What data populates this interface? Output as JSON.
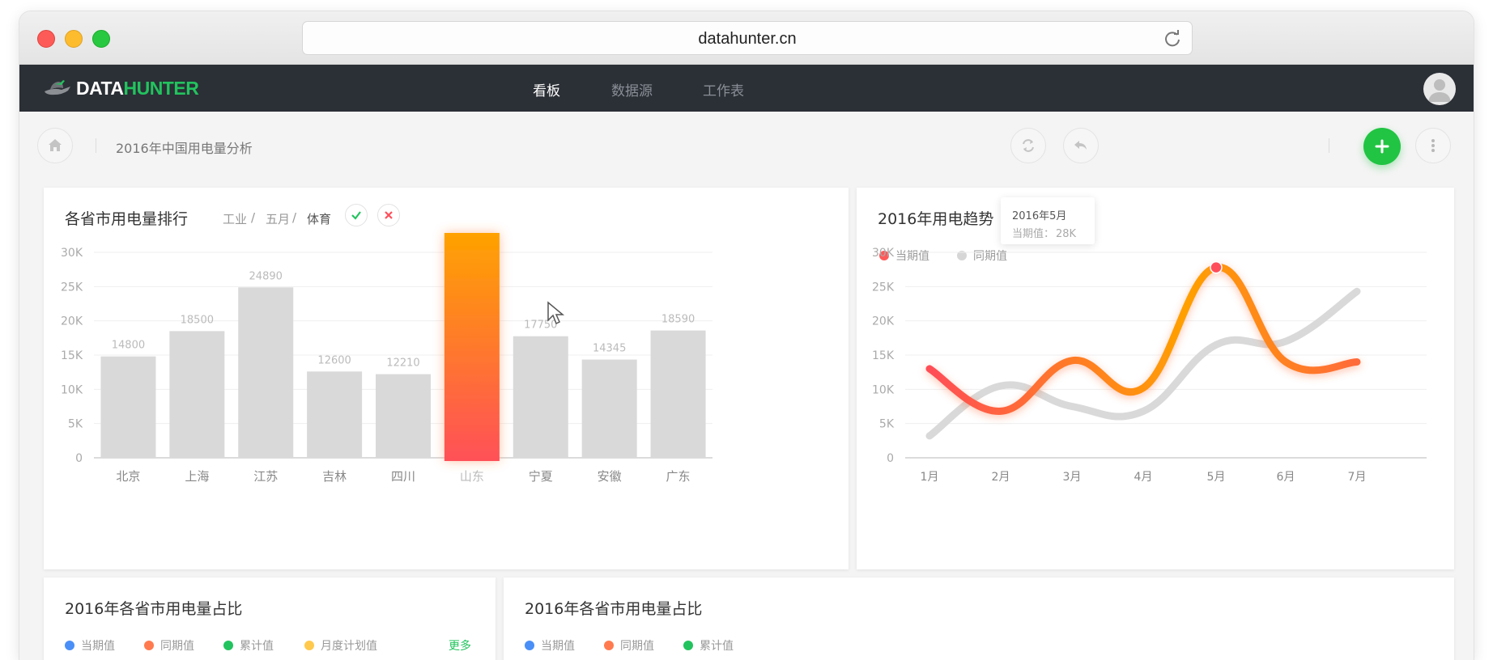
{
  "browser": {
    "url": "datahunter.cn"
  },
  "navbar": {
    "logo_part1": "DATA",
    "logo_part2": "HUNTER",
    "items": [
      {
        "label": "看板",
        "active": true
      },
      {
        "label": "数据源",
        "active": false
      },
      {
        "label": "工作表",
        "active": false
      }
    ]
  },
  "toolbar": {
    "breadcrumb": "2016年中国用电量分析"
  },
  "bar_card": {
    "title": "各省市用电量排行",
    "filters": [
      "工业",
      "五月",
      "体育"
    ],
    "separator": "/"
  },
  "line_card": {
    "title": "2016年用电趋势",
    "legend": [
      {
        "label": "当期值",
        "color": "#ff5a5a"
      },
      {
        "label": "同期值",
        "color": "#d6d6d6"
      }
    ],
    "tooltip": {
      "title": "2016年5月",
      "label": "当期值：",
      "value": "28K"
    }
  },
  "pie_card_left": {
    "title": "2016年各省市用电量占比",
    "legend": [
      {
        "label": "当期值",
        "color": "#4a8ff7"
      },
      {
        "label": "同期值",
        "color": "#ff7b4f"
      },
      {
        "label": "累计值",
        "color": "#22c35e"
      },
      {
        "label": "月度计划值",
        "color": "#ffc94d"
      }
    ],
    "more": "更多"
  },
  "pie_card_right": {
    "title": "2016年各省市用电量占比",
    "legend": [
      {
        "label": "当期值",
        "color": "#4a8ff7"
      },
      {
        "label": "同期值",
        "color": "#ff7b4f"
      },
      {
        "label": "累计值",
        "color": "#22c35e"
      }
    ]
  },
  "chart_data": [
    {
      "type": "bar",
      "title": "各省市用电量排行",
      "categories": [
        "北京",
        "上海",
        "江苏",
        "吉林",
        "四川",
        "山东",
        "宁夏",
        "安徽",
        "广东"
      ],
      "values": [
        14800,
        18500,
        24890,
        12600,
        12210,
        33000,
        17750,
        14345,
        18590
      ],
      "value_labels": [
        "14800",
        "18500",
        "24890",
        "12600",
        "12210",
        "",
        "17750",
        "14345",
        "18590"
      ],
      "highlight_index": 5,
      "yticks": [
        "0",
        "5K",
        "10K",
        "15K",
        "20K",
        "25K",
        "30K"
      ],
      "ylim": [
        0,
        30000
      ],
      "grid": true,
      "colors": {
        "bar": "#d9d9d9",
        "highlight_top": "#ffa200",
        "highlight_bottom": "#ff5058"
      }
    },
    {
      "type": "line",
      "title": "2016年用电趋势",
      "categories": [
        "1月",
        "2月",
        "3月",
        "4月",
        "5月",
        "6月",
        "7月"
      ],
      "series": [
        {
          "name": "当期值",
          "values": [
            13000,
            6800,
            14200,
            10200,
            27800,
            14000,
            14000
          ]
        },
        {
          "name": "同期值",
          "values": [
            3200,
            10500,
            7500,
            6800,
            16500,
            17000,
            24300
          ]
        }
      ],
      "yticks": [
        "0",
        "5K",
        "10K",
        "15K",
        "20K",
        "25K",
        "30K"
      ],
      "ylim": [
        0,
        30000
      ],
      "grid": true,
      "legend_position": "top-left"
    }
  ]
}
